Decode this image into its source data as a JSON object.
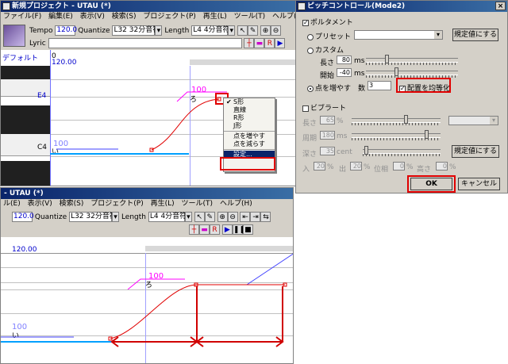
{
  "top_window": {
    "title": "新規プロジェクト - UTAU (*)",
    "menu": [
      "ファイル(F)",
      "編集(E)",
      "表示(V)",
      "検索(S)",
      "プロジェクト(P)",
      "再生(L)",
      "ツール(T)",
      "ヘルプ(H)"
    ],
    "tempo_label": "Tempo",
    "tempo_value": "120.0",
    "quantize_label": "Quantize",
    "quantize_value": "L32 32分音符",
    "length_label": "Length",
    "length_value": "L4  4分音符",
    "lyric_label": "Lyric",
    "track_label": "デフォルト",
    "ruler_bar": "0",
    "ruler_tempo": "120.00",
    "key_e4": "E4",
    "key_c4": "C4",
    "note1_vel": "100",
    "note1_lyric": "い",
    "note2_vel": "100",
    "note2_lyric": "ろ",
    "context_menu": [
      "S形",
      "直線",
      "R形",
      "J形",
      "点を増やす",
      "点を減らす",
      "設定..."
    ]
  },
  "bottom_window": {
    "title": "- UTAU (*)",
    "menu": [
      "ル(E)",
      "表示(V)",
      "検索(S)",
      "プロジェクト(P)",
      "再生(L)",
      "ツール(T)",
      "ヘルプ(H)"
    ],
    "tempo_value": "120.0",
    "quantize_label": "Quantize",
    "quantize_value": "L32 32分音符",
    "length_label": "Length",
    "length_value": "L4  4分音符",
    "ruler_tempo": "120.00",
    "note1_vel": "100",
    "note1_lyric": "い",
    "note2_vel": "100",
    "note2_lyric": "ろ"
  },
  "dialog": {
    "title": "ピッチコントロール(Mode2)",
    "portamento": "ポルタメント",
    "preset": "プリセット",
    "preset_default_btn": "規定値にする",
    "custom": "カスタム",
    "length_label": "長さ",
    "length_value": "80",
    "length_unit": "ms",
    "start_label": "開始",
    "start_value": "-40",
    "start_unit": "ms",
    "add_points": "点を増やす",
    "count_label": "数",
    "count_value": "3",
    "even_spacing": "配置を均等化",
    "vibrato": "ビブラート",
    "vib_length_label": "長さ",
    "vib_length_value": "65",
    "vib_length_unit": "%",
    "vib_cycle_label": "周期",
    "vib_cycle_value": "180",
    "vib_cycle_unit": "ms",
    "vib_depth_label": "深さ",
    "vib_depth_value": "35",
    "vib_depth_unit": "cent",
    "vib_default_btn": "規定値にする",
    "in_label": "入",
    "in_value": "20",
    "out_label": "出",
    "out_value": "20",
    "phase_label": "位相",
    "phase_value": "0",
    "height_label": "高さ",
    "height_value": "0",
    "pct": "%",
    "ok": "OK",
    "cancel": "キャンセル"
  },
  "colors": {
    "titlebar": "#0a246a",
    "pitch_curve": "#e00000",
    "note_bar": "#00a0ff",
    "highlight": "#e00000",
    "vel_text": "#ff00ff"
  }
}
